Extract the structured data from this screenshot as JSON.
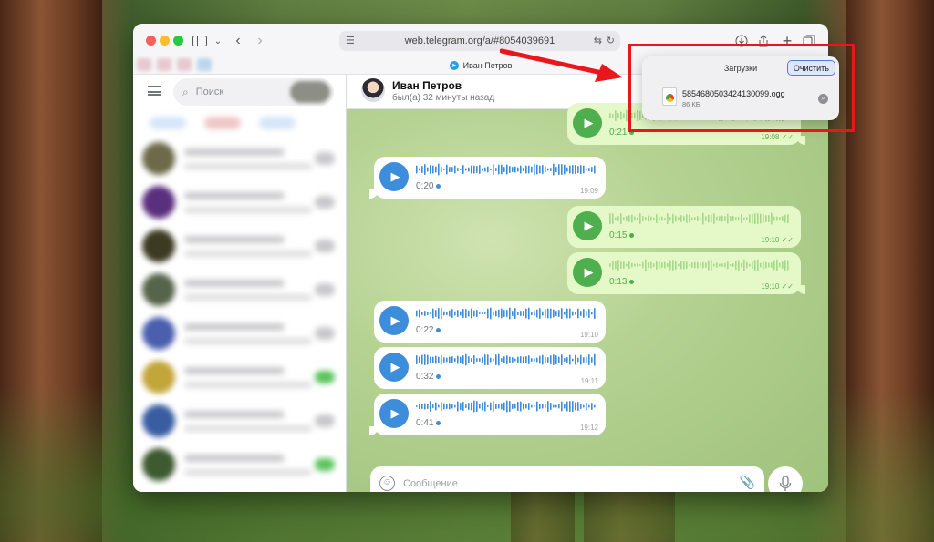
{
  "browser": {
    "url": "web.telegram.org/a/#8054039691",
    "tab_title": "Иван Петров",
    "icons": [
      "sidebar-icon",
      "back-icon",
      "forward-icon",
      "translate-icon",
      "reload-icon",
      "download-icon",
      "share-icon",
      "new-tab-icon",
      "tabs-overview-icon"
    ]
  },
  "sidebar": {
    "search_placeholder": "Поиск"
  },
  "chat": {
    "contact_name": "Иван Петров",
    "contact_status": "был(а) 32 минуты назад",
    "messages": [
      {
        "direction": "out",
        "duration": "0:21",
        "time": "19:08"
      },
      {
        "direction": "in",
        "duration": "0:20",
        "time": "19:09"
      },
      {
        "direction": "out",
        "duration": "0:15",
        "time": "19:10"
      },
      {
        "direction": "out",
        "duration": "0:13",
        "time": "19:10"
      },
      {
        "direction": "in",
        "duration": "0:22",
        "time": "19:10"
      },
      {
        "direction": "in",
        "duration": "0:32",
        "time": "19:11"
      },
      {
        "direction": "in",
        "duration": "0:41",
        "time": "19:12"
      }
    ],
    "composer_placeholder": "Сообщение"
  },
  "downloads": {
    "title": "Загрузки",
    "clear_label": "Очистить",
    "file_name": "5854680503424130099.ogg",
    "file_size": "86 КБ"
  },
  "colors": {
    "annotation_red": "#e8171b",
    "incoming_play": "#3e8ddb",
    "outgoing_play": "#4fae4e",
    "outgoing_bubble": "#e4f8c8"
  }
}
